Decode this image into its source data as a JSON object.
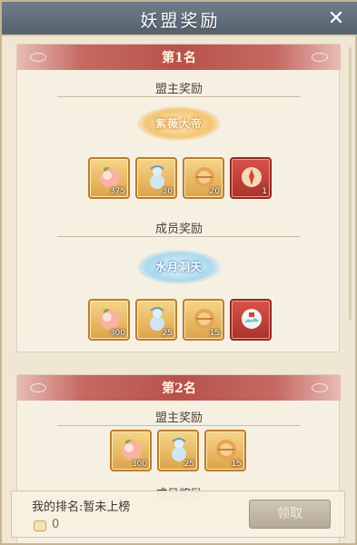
{
  "header": {
    "title": "妖盟奖励",
    "close_glyph": "✕"
  },
  "ranks": [
    {
      "label": "第1名",
      "leader_title": "盟主奖励",
      "leader_emblem": "紫薇大帝",
      "leader_items": [
        {
          "icon": "peach-icon",
          "qty": "375",
          "frame": "gold"
        },
        {
          "icon": "gourd-icon",
          "qty": "30",
          "frame": "gold"
        },
        {
          "icon": "orb-icon",
          "qty": "20",
          "frame": "gold"
        },
        {
          "icon": "fire-seal-icon",
          "qty": "1",
          "frame": "red"
        }
      ],
      "member_title": "成员奖励",
      "member_emblem": "水月洞天",
      "member_items": [
        {
          "icon": "peach-icon",
          "qty": "300",
          "frame": "gold"
        },
        {
          "icon": "gourd-icon",
          "qty": "25",
          "frame": "gold"
        },
        {
          "icon": "orb-icon",
          "qty": "15",
          "frame": "gold"
        },
        {
          "icon": "cloud-palace-icon",
          "qty": "",
          "frame": "red"
        }
      ]
    },
    {
      "label": "第2名",
      "leader_title": "盟主奖励",
      "leader_items": [
        {
          "icon": "peach-icon",
          "qty": "300",
          "frame": "gold"
        },
        {
          "icon": "gourd-icon",
          "qty": "25",
          "frame": "gold"
        },
        {
          "icon": "orb-icon",
          "qty": "15",
          "frame": "gold"
        }
      ],
      "member_title_partial": "成员奖励"
    }
  ],
  "footer": {
    "my_rank_label": "我的排名:暂未上榜",
    "points": "0",
    "claim_label": "领取"
  },
  "colors": {
    "banner_red": "#b8514c",
    "gold_frame": "#dda24a",
    "red_frame": "#a9332b"
  }
}
